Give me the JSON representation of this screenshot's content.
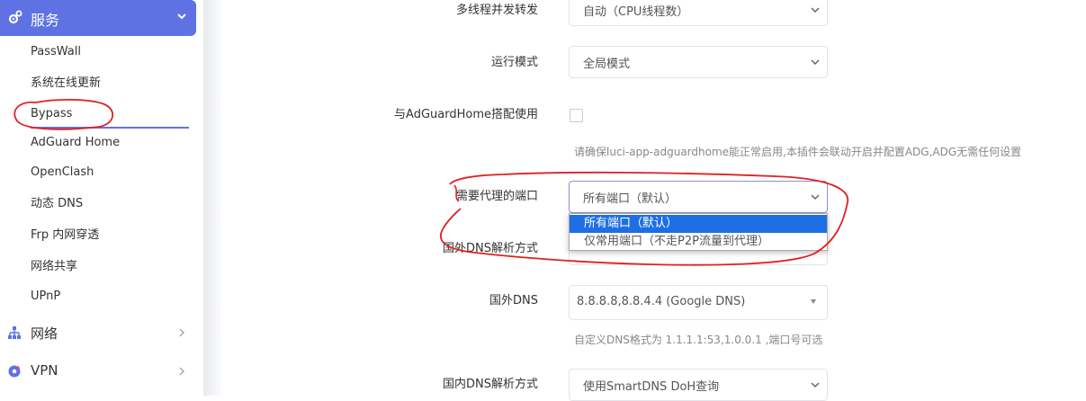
{
  "sidebar": {
    "service_menu": {
      "label": "服务"
    },
    "items": [
      {
        "label": "PassWall"
      },
      {
        "label": "系统在线更新"
      },
      {
        "label": "Bypass"
      },
      {
        "label": "AdGuard Home"
      },
      {
        "label": "OpenClash"
      },
      {
        "label": "动态 DNS"
      },
      {
        "label": "Frp 内网穿透"
      },
      {
        "label": "网络共享"
      },
      {
        "label": "UPnP"
      }
    ],
    "network_menu": {
      "label": "网络"
    },
    "vpn_menu": {
      "label": "VPN"
    }
  },
  "form": {
    "threads": {
      "label": "多线程并发转发",
      "value": "自动（CPU线程数）"
    },
    "mode": {
      "label": "运行模式",
      "value": "全局模式"
    },
    "adguard": {
      "label": "与AdGuardHome搭配使用",
      "hint": "请确保luci-app-adguardhome能正常启用,本插件会联动开启并配置ADG,ADG无需任何设置"
    },
    "ports": {
      "label": "需要代理的端口",
      "value": "所有端口（默认）",
      "options": [
        "所有端口（默认）",
        "仅常用端口（不走P2P流量到代理）"
      ]
    },
    "foreign_dns_mode": {
      "label": "国外DNS解析方式"
    },
    "foreign_dns": {
      "label": "国外DNS",
      "value": "8.8.8.8,8.8.4.4 (Google DNS)",
      "hint": "自定义DNS格式为 1.1.1.1:53,1.0.0.1 ,端口号可选"
    },
    "domestic_dns_mode": {
      "label": "国内DNS解析方式",
      "value": "使用SmartDNS DoH查询"
    }
  },
  "colors": {
    "accent": "#5e72e4",
    "selection": "#1e6fe3",
    "annotation": "#e02020"
  },
  "icons": {
    "service": "gear-icon",
    "network": "network-icon",
    "vpn": "vpn-icon"
  }
}
